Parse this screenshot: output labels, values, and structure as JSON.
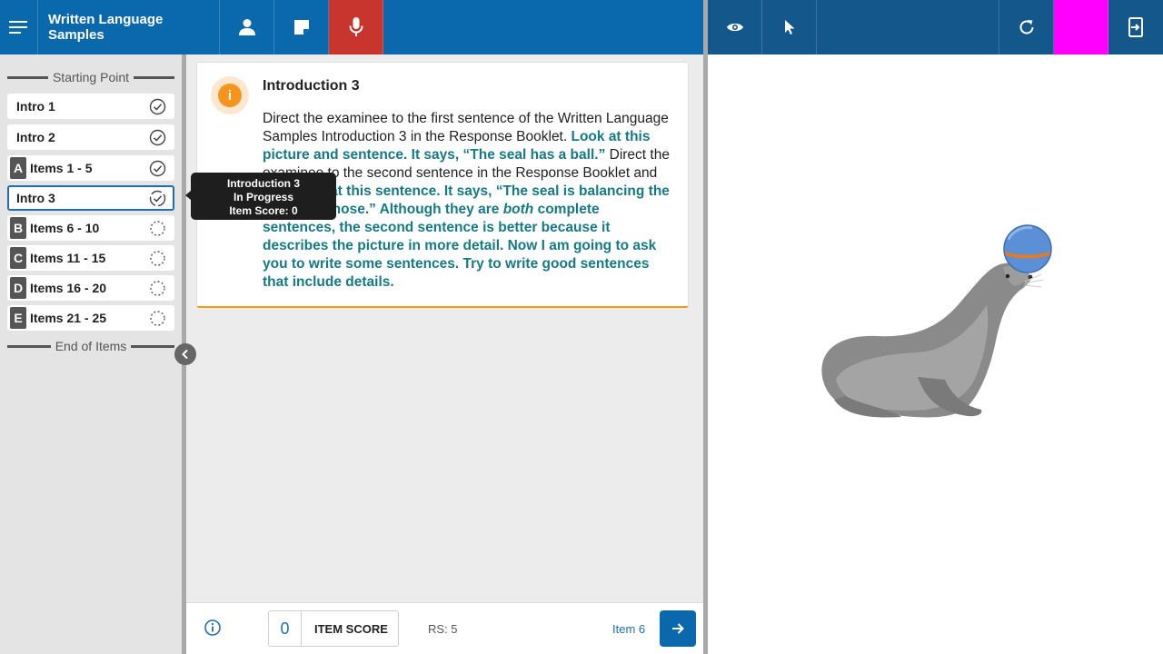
{
  "header": {
    "title": "Written Language Samples",
    "icons": [
      "menu-icon",
      "person-icon",
      "note-icon",
      "microphone-icon",
      "eye-icon",
      "pointer-icon",
      "refresh-icon",
      "exit-icon"
    ],
    "mic_color": "#c8342e",
    "magenta_color": "#ff00ff"
  },
  "sidebar": {
    "start_label": "Starting Point",
    "end_label": "End of Items",
    "items": [
      {
        "badge": "",
        "label": "Intro 1",
        "status": "complete"
      },
      {
        "badge": "",
        "label": "Intro 2",
        "status": "complete"
      },
      {
        "badge": "A",
        "label": "Items 1 - 5",
        "status": "complete"
      },
      {
        "badge": "",
        "label": "Intro 3",
        "status": "in-progress"
      },
      {
        "badge": "B",
        "label": "Items 6 - 10",
        "status": "not-started"
      },
      {
        "badge": "C",
        "label": "Items 11 - 15",
        "status": "not-started"
      },
      {
        "badge": "D",
        "label": "Items 16 - 20",
        "status": "not-started"
      },
      {
        "badge": "E",
        "label": "Items 21 - 25",
        "status": "not-started"
      }
    ]
  },
  "tooltip": {
    "line1": "Introduction 3",
    "line2": "In Progress",
    "line3": "Item Score: 0"
  },
  "card": {
    "title": "Introduction 3",
    "p1": "Direct the examinee to the first sentence of the Written Language Samples Introduction 3 in the Response Booklet. ",
    "s1": "Look at this picture and sentence. It says, “The seal has a ball.”",
    "p2": " Direct the examinee to the second sentence in the Response Booklet and say: ",
    "s2a": "Look at this sentence. It says, “The seal is balancing the ball on its nose.” Although they are ",
    "s2em": "both",
    "s2b": " complete sentences, the second sentence is better because it describes the picture in more detail. Now I am going to ask you to write some sentences. Try to write good sentences that include details."
  },
  "footer": {
    "item_score_value": "0",
    "item_score_label": "ITEM SCORE",
    "rs": "RS: 5",
    "item": "Item 6"
  }
}
